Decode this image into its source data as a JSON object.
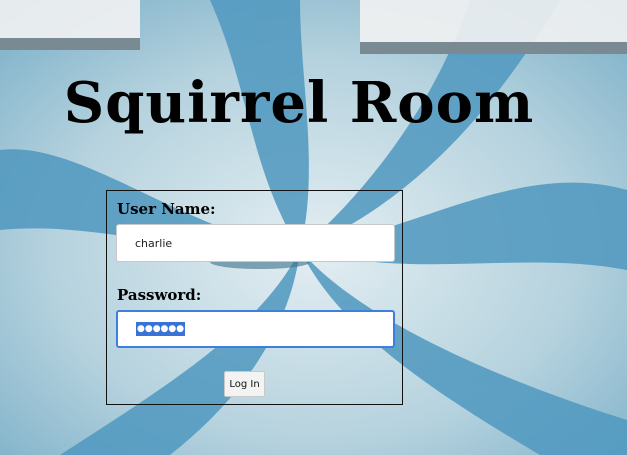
{
  "page": {
    "title": "Squirrel Room"
  },
  "form": {
    "username_label": "User Name:",
    "username_value": "charlie",
    "password_label": "Password:",
    "password_mask": "●●●●●●",
    "login_label": "Log In"
  },
  "colors": {
    "focus_border": "#3d7fdc",
    "selection": "#3874d8"
  }
}
